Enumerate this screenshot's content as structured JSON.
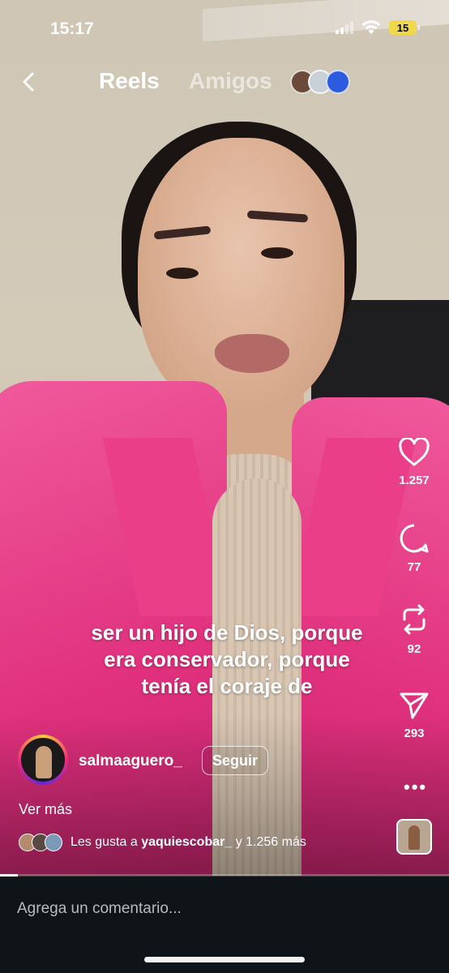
{
  "status_bar": {
    "time": "15:17",
    "battery": "15"
  },
  "header": {
    "tab_reels": "Reels",
    "tab_friends": "Amigos"
  },
  "video": {
    "caption_lines": [
      "ser un hijo de Dios, porque",
      "era conservador, porque",
      "tenía el coraje de"
    ]
  },
  "actions": {
    "likes_count": "1.257",
    "comments_count": "77",
    "reposts_count": "92",
    "shares_count": "293"
  },
  "author": {
    "username": "salmaaguero_",
    "follow_label": "Seguir",
    "see_more": "Ver más"
  },
  "likes_summary": {
    "prefix": "Les gusta a",
    "user": "yaquiescobar_",
    "suffix": "y 1.256 más"
  },
  "comment_bar": {
    "placeholder": "Agrega un comentario..."
  },
  "colors": {
    "accent": "#e0307d",
    "battery": "#f0d84a",
    "bar_bg": "#0f1418"
  },
  "icons": {
    "back": "chevron-left-icon",
    "like": "heart-icon",
    "comment": "comment-bubble-icon",
    "repost": "repost-icon",
    "share": "paper-plane-icon",
    "more": "more-dots-icon"
  }
}
